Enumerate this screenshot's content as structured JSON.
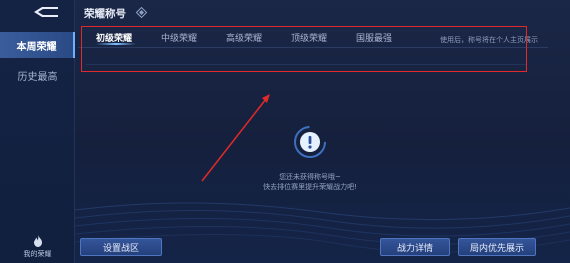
{
  "sidebar": {
    "items": [
      {
        "label": "本周荣耀",
        "active": true
      },
      {
        "label": "历史最高",
        "active": false
      }
    ],
    "bottom_label": "我的荣耀"
  },
  "header": {
    "title": "荣耀称号"
  },
  "tabs": [
    {
      "label": "初级荣耀",
      "active": true
    },
    {
      "label": "中级荣耀",
      "active": false
    },
    {
      "label": "高级荣耀",
      "active": false
    },
    {
      "label": "顶级荣耀",
      "active": false
    },
    {
      "label": "国服最强",
      "active": false
    }
  ],
  "tabs_hint": "使用后，称号将在个人主页展示",
  "empty_state": {
    "line1": "您还未获得称号哦~",
    "line2": "快去排位赛里提升荣耀战力吧!"
  },
  "buttons": {
    "server": "设置战区",
    "detail": "战力详情",
    "priority": "局内优先展示"
  },
  "colors": {
    "annotation": "#e02a2a",
    "accent": "#6fb0ff",
    "background": "#16213f"
  }
}
